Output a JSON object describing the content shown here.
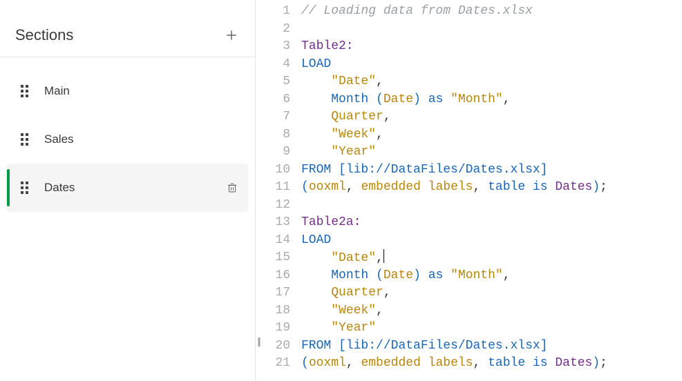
{
  "sidebar": {
    "title": "Sections",
    "items": [
      {
        "label": "Main",
        "active": false
      },
      {
        "label": "Sales",
        "active": false
      },
      {
        "label": "Dates",
        "active": true
      }
    ]
  },
  "editor": {
    "lines": [
      {
        "n": 1,
        "t": "comment",
        "raw": "// Loading data from Dates.xlsx"
      },
      {
        "n": 2,
        "t": "blank",
        "raw": ""
      },
      {
        "n": 3,
        "t": "table",
        "raw": "Table2:"
      },
      {
        "n": 4,
        "t": "load",
        "raw": "LOAD"
      },
      {
        "n": 5,
        "t": "fieldc",
        "indent": "    ",
        "field": "\"Date\""
      },
      {
        "n": 6,
        "t": "month",
        "indent": "    ",
        "fn": "Month",
        "arg": "Date",
        "as": "as",
        "alias": "\"Month\""
      },
      {
        "n": 7,
        "t": "identc",
        "indent": "    ",
        "ident": "Quarter"
      },
      {
        "n": 8,
        "t": "fieldc",
        "indent": "    ",
        "field": "\"Week\""
      },
      {
        "n": 9,
        "t": "field",
        "indent": "    ",
        "field": "\"Year\""
      },
      {
        "n": 10,
        "t": "from",
        "kw": "FROM",
        "path": "[lib://DataFiles/Dates.xlsx]"
      },
      {
        "n": 11,
        "t": "opts",
        "p1": "ooxml",
        "p2": "embedded labels",
        "kw": "table is",
        "tref": "Dates"
      },
      {
        "n": 12,
        "t": "blank",
        "raw": ""
      },
      {
        "n": 13,
        "t": "table",
        "raw": "Table2a:"
      },
      {
        "n": 14,
        "t": "load",
        "raw": "LOAD"
      },
      {
        "n": 15,
        "t": "fieldc",
        "indent": "    ",
        "field": "\"Date\"",
        "cursor": true
      },
      {
        "n": 16,
        "t": "month",
        "indent": "    ",
        "fn": "Month",
        "arg": "Date",
        "as": "as",
        "alias": "\"Month\""
      },
      {
        "n": 17,
        "t": "identc",
        "indent": "    ",
        "ident": "Quarter"
      },
      {
        "n": 18,
        "t": "fieldc",
        "indent": "    ",
        "field": "\"Week\""
      },
      {
        "n": 19,
        "t": "field",
        "indent": "    ",
        "field": "\"Year\""
      },
      {
        "n": 20,
        "t": "from",
        "kw": "FROM",
        "path": "[lib://DataFiles/Dates.xlsx]"
      },
      {
        "n": 21,
        "t": "opts",
        "p1": "ooxml",
        "p2": "embedded labels",
        "kw": "table is",
        "tref": "Dates"
      }
    ]
  }
}
